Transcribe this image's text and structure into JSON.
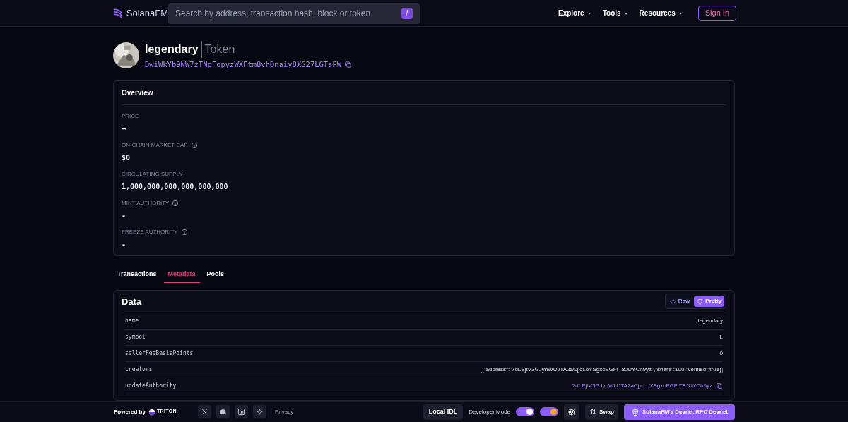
{
  "header": {
    "logo": "SolanaFM",
    "search": {
      "placeholder": "Search by address, transaction hash, block or token",
      "shortcut": "/"
    },
    "nav": [
      "Explore",
      "Tools",
      "Resources"
    ],
    "sign_in": "Sign In"
  },
  "token": {
    "name": "legendary",
    "type": "Token",
    "address": "DwiWkYb9NW7zTNpFopyzWXFtm8vhDnaiy8XG27LGTsPW"
  },
  "overview": {
    "title": "Overview",
    "fields": [
      {
        "label": "PRICE",
        "value": "–",
        "info": false
      },
      {
        "label": "ON-CHAIN MARKET CAP",
        "value": "$0",
        "info": true
      },
      {
        "label": "CIRCULATING SUPPLY",
        "value": "1,000,000,000,000,000,000",
        "info": false
      },
      {
        "label": "MINT AUTHORITY",
        "value": "-",
        "info": true
      },
      {
        "label": "FREEZE AUTHORITY",
        "value": "-",
        "info": true
      }
    ]
  },
  "tabs": [
    {
      "label": "Transactions",
      "selected": false
    },
    {
      "label": "Metadata",
      "selected": true
    },
    {
      "label": "Pools",
      "selected": false
    }
  ],
  "data": {
    "title": "Data",
    "views": [
      {
        "label": "Raw",
        "selected": false
      },
      {
        "label": "Pretty",
        "selected": true
      }
    ],
    "rows": [
      {
        "key": "name",
        "value": "legendary",
        "kind": "text"
      },
      {
        "key": "symbol",
        "value": "L",
        "kind": "text"
      },
      {
        "key": "sellerFeeBasisPoints",
        "value": "0",
        "kind": "text"
      },
      {
        "key": "creators",
        "value": "[{\"address\":\"7dLEjtV3GJyhWUJTA2aCjjcLoYSgxcEGFtT8JUYCh9yz\",\"share\":100,\"verified\":true}]",
        "kind": "text"
      },
      {
        "key": "updateAuthority",
        "value": "7dLEjtV3GJyhWUJTA2aCjjcLoYSgxcEGFtT8JUYCh9yz",
        "kind": "address"
      }
    ]
  },
  "footer": {
    "powered_by": "Powered by",
    "brand": "TRITON",
    "privacy": "Privacy",
    "local_idl": "Local IDL",
    "developer_mode": {
      "label": "Developer Mode",
      "on": true
    },
    "theme_on": true,
    "swap": "Swap",
    "network": "SolanaFM's Devnet RPC Devnet"
  }
}
